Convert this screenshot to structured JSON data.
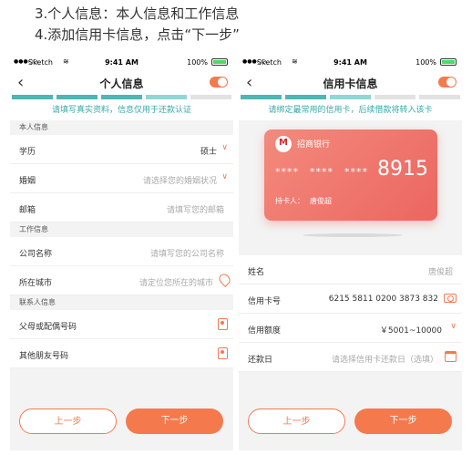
{
  "captions": {
    "line1": "3.个人信息：本人信息和工作信息",
    "line2": "4.添加信用卡信息，点击“下一步”"
  },
  "status": {
    "carrier": "Sketch",
    "time": "9:41 AM",
    "battery": "100%"
  },
  "colors": {
    "accent": "#f47a4e",
    "teal": "#4fb5b5",
    "teal_light": "#8fd6d6",
    "inactive": "#e2e2e2"
  },
  "left": {
    "title": "个人信息",
    "notice": "请填写真实资料，信息仅用于还款认证",
    "progress": [
      "done",
      "done",
      "done",
      "current",
      "todo"
    ],
    "personal_section": "本人信息",
    "education_label": "学历",
    "education_value": "硕士",
    "marriage_label": "婚姻",
    "marriage_placeholder": "请选择您的婚姻状况",
    "email_label": "邮箱",
    "email_placeholder": "请填写您的邮箱",
    "work_section": "工作信息",
    "company_label": "公司名称",
    "company_placeholder": "请填写您的公司名称",
    "city_label": "所在城市",
    "city_placeholder": "请定位您所在的城市",
    "contact_section": "联系人信息",
    "parent_label": "父母或配偶号码",
    "friend_label": "其他朋友号码",
    "prev_label": "上一步",
    "next_label": "下一步"
  },
  "right": {
    "title": "信用卡信息",
    "notice": "请绑定最常用的信用卡，后续借款将转入该卡",
    "progress": [
      "done",
      "done",
      "current",
      "todo",
      "todo"
    ],
    "card": {
      "bank": "招商银行",
      "mask1": "****",
      "mask2": "****",
      "mask3": "****",
      "last4": "8915",
      "holder_label": "持卡人：",
      "holder_name": "唐俊超"
    },
    "name_label": "姓名",
    "name_value": "唐俊超",
    "card_label": "信用卡号",
    "card_value": "6215 5811 0200 3873 832",
    "limit_label": "信用额度",
    "limit_value": "￥5001~10000",
    "due_label": "还款日",
    "due_placeholder": "请选择信用卡还款日（选填）",
    "prev_label": "上一步",
    "next_label": "下一步"
  }
}
